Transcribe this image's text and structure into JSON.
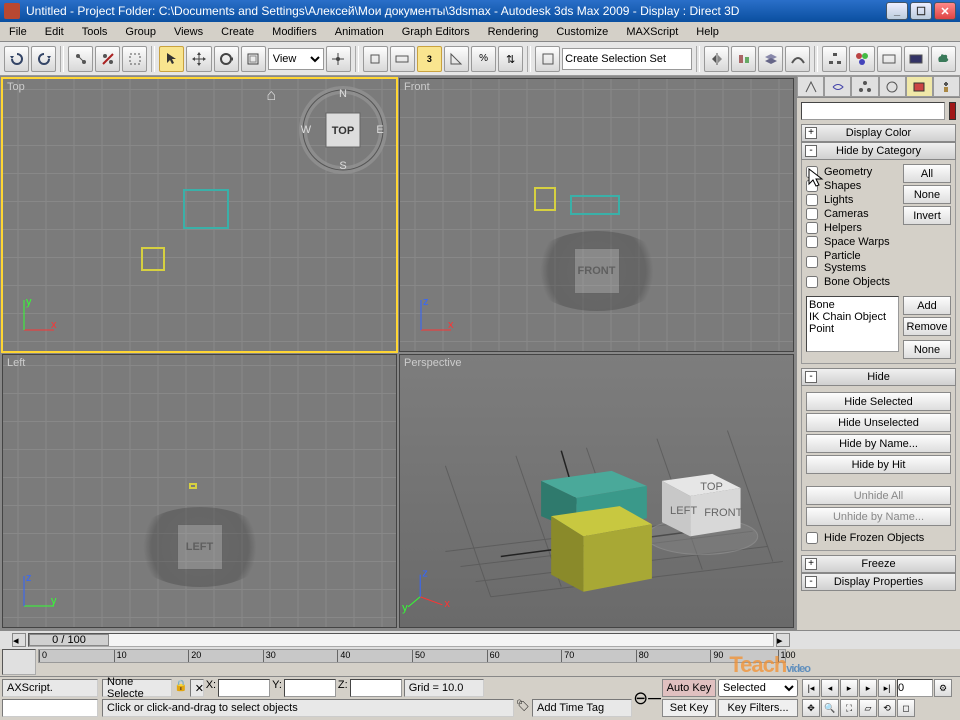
{
  "title": "Untitled   -  Project Folder: C:\\Documents and Settings\\Алексей\\Мои документы\\3dsmax   -  Autodesk 3ds Max  2009   -   Display : Direct 3D",
  "menus": [
    "File",
    "Edit",
    "Tools",
    "Group",
    "Views",
    "Create",
    "Modifiers",
    "Animation",
    "Graph Editors",
    "Rendering",
    "Customize",
    "MAXScript",
    "Help"
  ],
  "toolbar": {
    "view_select": "View",
    "selset": "Create Selection Set"
  },
  "viewports": {
    "top": "Top",
    "front": "Front",
    "left": "Left",
    "persp": "Perspective"
  },
  "viewcube": {
    "face": "TOP",
    "front": "FRONT",
    "left": "LEFT"
  },
  "panel": {
    "displayColor": "Display Color",
    "hideByCategory": "Hide by Category",
    "cats": {
      "geometry": "Geometry",
      "shapes": "Shapes",
      "lights": "Lights",
      "cameras": "Cameras",
      "helpers": "Helpers",
      "spacewarps": "Space Warps",
      "particle": "Particle Systems",
      "bone": "Bone Objects"
    },
    "all": "All",
    "none": "None",
    "invert": "Invert",
    "listitems": [
      "Bone",
      "IK Chain Object",
      "Point"
    ],
    "add": "Add",
    "remove": "Remove",
    "none2": "None",
    "hide": "Hide",
    "hideSelected": "Hide Selected",
    "hideUnselected": "Hide Unselected",
    "hideByName": "Hide by Name...",
    "hideByHit": "Hide by Hit",
    "unhideAll": "Unhide All",
    "unhideByName": "Unhide by Name...",
    "hideFrozen": "Hide Frozen Objects",
    "freeze": "Freeze",
    "displayProps": "Display Properties"
  },
  "timeline": {
    "frame": "0 / 100",
    "ticks": [
      0,
      10,
      20,
      30,
      40,
      50,
      60,
      70,
      80,
      90,
      100
    ]
  },
  "status": {
    "script": "AXScript.",
    "sel": "None Selecte",
    "prompt": "Click or click-and-drag to select objects",
    "x": "X:",
    "y": "Y:",
    "z": "Z:",
    "grid": "Grid = 10.0",
    "addtag": "Add Time Tag",
    "autokey": "Auto Key",
    "setkey": "Set Key",
    "selected": "Selected",
    "keyfilters": "Key Filters..."
  }
}
